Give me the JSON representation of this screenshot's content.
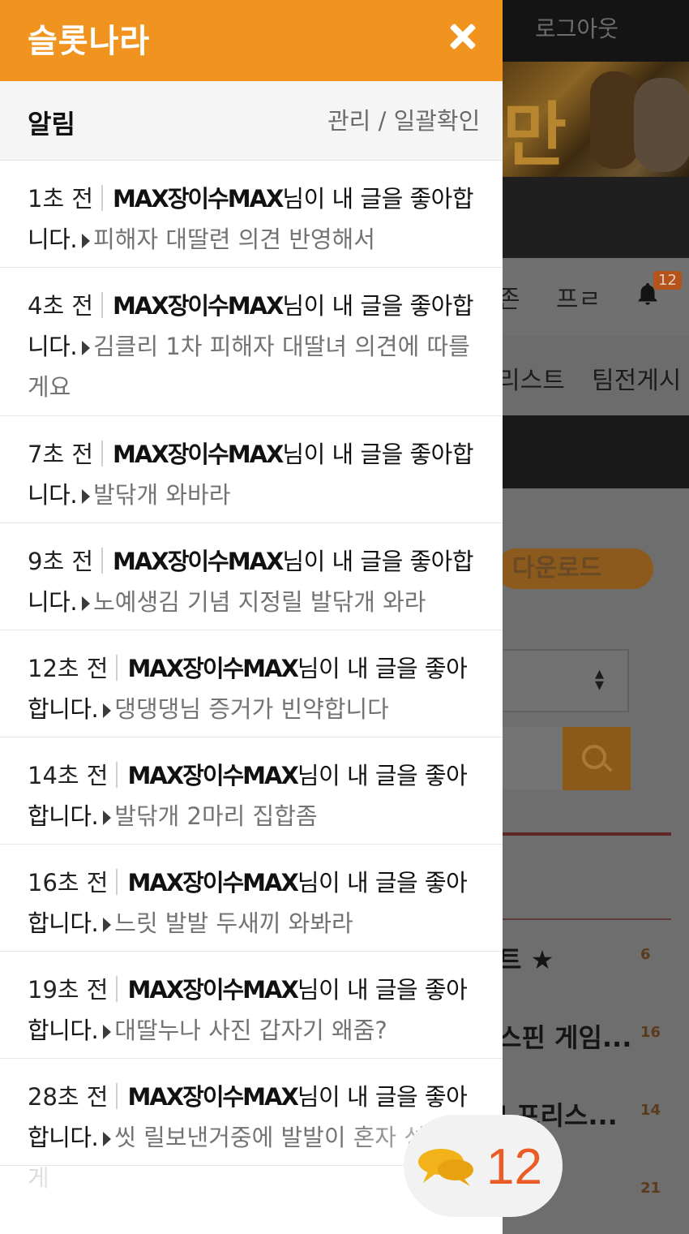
{
  "background_page": {
    "logout_label": "로그아웃",
    "banner_text": "만",
    "nav_row1": [
      "존",
      "프ㄹ"
    ],
    "notification_badge": "12",
    "nav_row2": [
      "리스트",
      "팀전게시"
    ],
    "download_label": "다운로드",
    "list_items": [
      {
        "title": "트 ★",
        "count": "6"
      },
      {
        "title": "스핀 게임...",
        "count": "16"
      },
      {
        "title": "I 프리스...",
        "count": "14"
      },
      {
        "title": "",
        "count": "21"
      }
    ]
  },
  "drawer": {
    "brand": "슬롯나라",
    "section_title": "알림",
    "actions_label": "관리 / 일괄확인",
    "notifications": [
      {
        "time": "1초 전",
        "user": "MAX장이수MAX",
        "message": "님이 내 글을 좋아합니다.",
        "post": "피해자 대딸련 의견 반영해서"
      },
      {
        "time": "4초 전",
        "user": "MAX장이수MAX",
        "message": "님이 내 글을 좋아합니다.",
        "post": "김클리 1차 피해자 대딸녀 의견에 따를게요"
      },
      {
        "time": "7초 전",
        "user": "MAX장이수MAX",
        "message": "님이 내 글을 좋아합니다.",
        "post": "발닦개 와바라"
      },
      {
        "time": "9초 전",
        "user": "MAX장이수MAX",
        "message": "님이 내 글을 좋아합니다.",
        "post": "노예생김 기념 지정릴 발닦개 와라"
      },
      {
        "time": "12초 전",
        "user": "MAX장이수MAX",
        "message": "님이 내 글을 좋아합니다.",
        "post": "댕댕댕님 증거가 빈약합니다"
      },
      {
        "time": "14초 전",
        "user": "MAX장이수MAX",
        "message": "님이 내 글을 좋아합니다.",
        "post": "발닦개 2마리 집합좀"
      },
      {
        "time": "16초 전",
        "user": "MAX장이수MAX",
        "message": "님이 내 글을 좋아합니다.",
        "post": "느릿 발발 두새끼 와봐라"
      },
      {
        "time": "19초 전",
        "user": "MAX장이수MAX",
        "message": "님이 내 글을 좋아합니다.",
        "post": "대딸누나 사진 갑자기 왜줌?"
      },
      {
        "time": "28초 전",
        "user": "MAX장이수MAX",
        "message": "님이 내 글을 좋아합니다.",
        "post": "씻 릴보낸거중에 발발이 혼자 성공한게"
      }
    ]
  },
  "chat": {
    "count": "12"
  },
  "colors": {
    "brand": "#f0941f",
    "chat_count": "#ea5b26"
  }
}
